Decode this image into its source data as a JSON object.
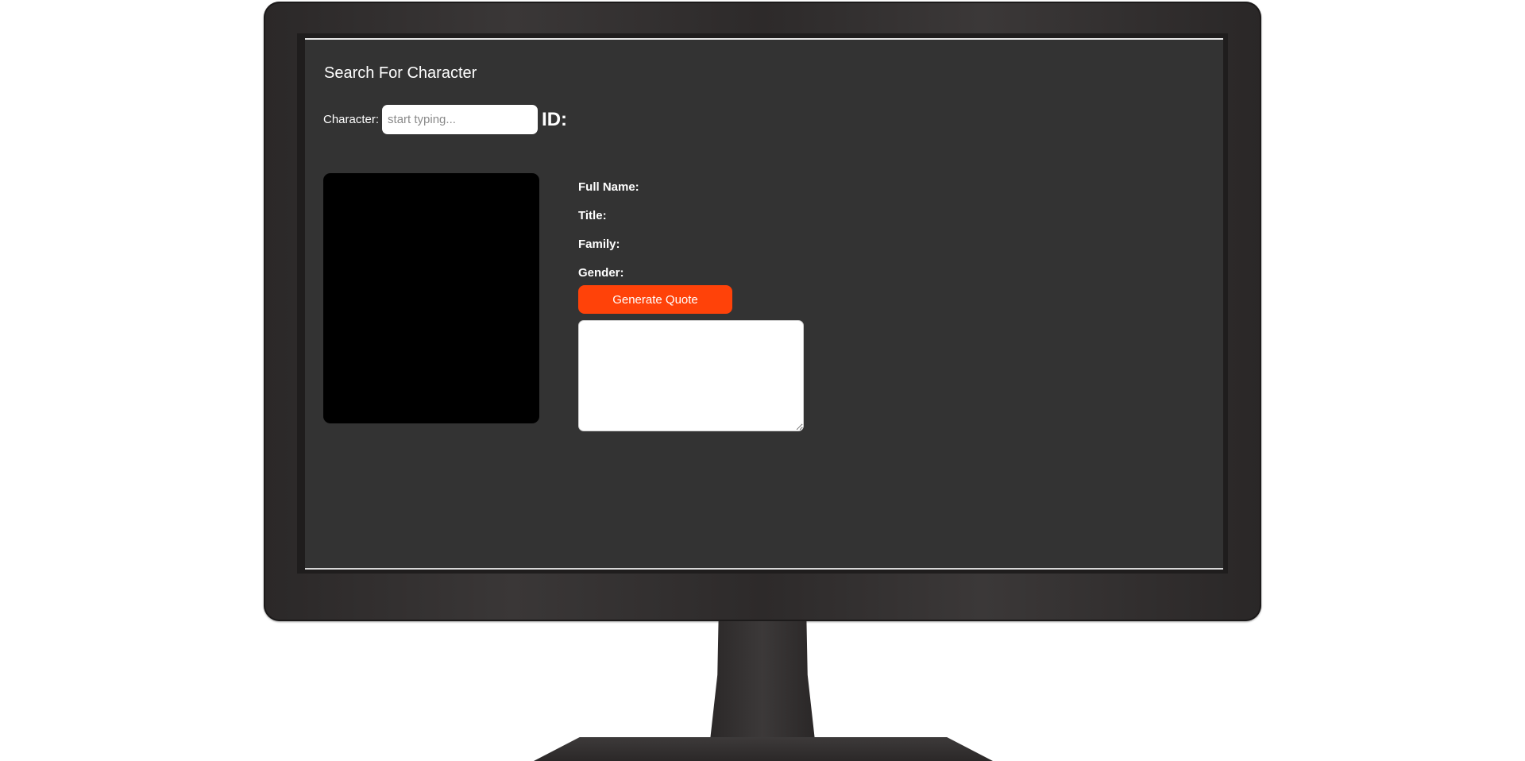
{
  "page": {
    "title": "Search For Character"
  },
  "search": {
    "label": "Character:",
    "placeholder": "start typing...",
    "value": "",
    "id_label": "ID:"
  },
  "details": {
    "full_name_label": "Full Name:",
    "title_label": "Title:",
    "family_label": "Family:",
    "gender_label": "Gender:"
  },
  "actions": {
    "generate_quote_label": "Generate Quote"
  },
  "quote": {
    "value": ""
  },
  "colors": {
    "screen_bg": "#333333",
    "accent_button": "#ff4209",
    "portrait_bg": "#000000",
    "bezel": "#2f2c2c"
  }
}
